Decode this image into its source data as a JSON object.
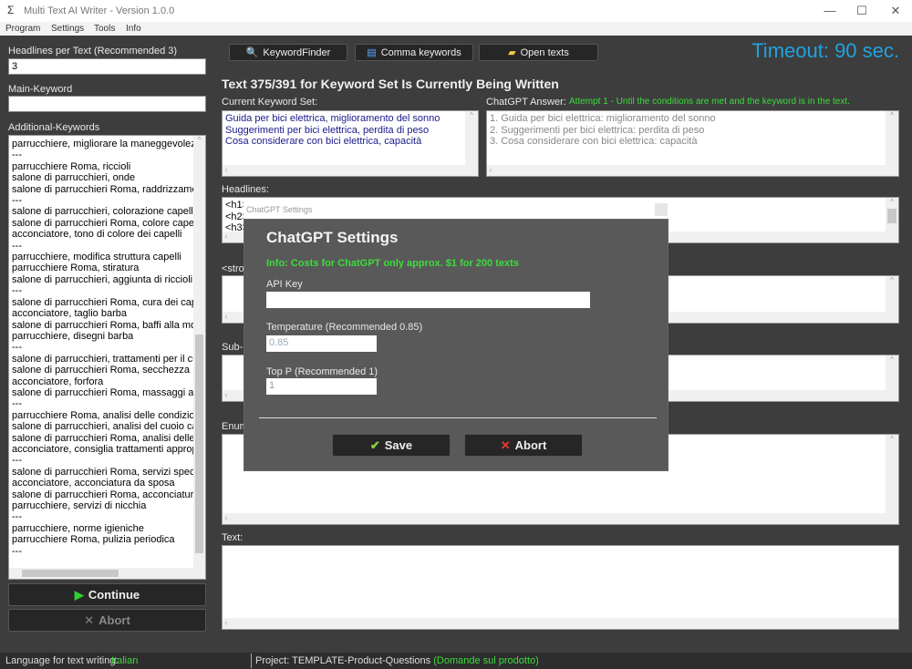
{
  "window": {
    "title": "Multi Text AI Writer - Version 1.0.0",
    "minimize": "—",
    "maximize": "☐",
    "close": "✕"
  },
  "menu": [
    "Program",
    "Settings",
    "Tools",
    "Info"
  ],
  "left": {
    "headlines_label": "Headlines per Text (Recommended 3)",
    "headlines_value": "3",
    "main_keyword_label": "Main-Keyword",
    "main_keyword_value": "",
    "additional_label": "Additional-Keywords",
    "additional_keywords": [
      "parrucchiere, migliorare la maneggevolezza",
      "---",
      "parrucchiere Roma, riccioli",
      "salone di parrucchieri, onde",
      "salone di parrucchieri Roma, raddrizzamento",
      "---",
      "salone di parrucchieri, colorazione capelli",
      "salone di parrucchieri Roma, colore capelli",
      "acconciatore, tono di colore dei capelli",
      "---",
      "parrucchiere, modifica struttura capelli",
      "parrucchiere Roma, stiratura",
      "salone di parrucchieri, aggiunta di riccioli",
      "---",
      "salone di parrucchieri Roma, cura dei capelli",
      "acconciatore, taglio barba",
      "salone di parrucchieri Roma, baffi alla moda",
      "parrucchiere, disegni barba",
      "---",
      "salone di parrucchieri, trattamenti per il cuoio",
      "salone di parrucchieri Roma, secchezza",
      "acconciatore, forfora",
      "salone di parrucchieri Roma, massaggi al cuoio",
      "---",
      "parrucchiere Roma, analisi delle condizioni",
      "salone di parrucchieri, analisi del cuoio capelluto",
      "salone di parrucchieri Roma, analisi delle condizioni",
      "acconciatore, consiglia trattamenti appropriati",
      "---",
      "salone di parrucchieri Roma, servizi speciali",
      "acconciatore, acconciatura da sposa",
      "salone di parrucchieri Roma, acconciature di",
      "parrucchiere, servizi di nicchia",
      "---",
      "parrucchiere, norme igieniche",
      "parrucchiere Roma, pulizia periodica",
      "---"
    ],
    "continue_label": "Continue",
    "abort_label": "Abort"
  },
  "toolbar": {
    "keywordfinder": "KeywordFinder",
    "comma_keywords": "Comma keywords",
    "open_texts": "Open texts"
  },
  "timeout": "Timeout: 90 sec.",
  "heading": "Text 375/391 for Keyword Set Is Currently Being Written",
  "current_set": {
    "label": "Current Keyword Set:",
    "lines": "Guida per bici elettrica, miglioramento del sonno\nSuggerimenti per bici elettrica, perdita di peso\nCosa considerare con bici elettrica, capacità"
  },
  "answer": {
    "label": "ChatGPT Answer:",
    "status": "Attempt 1 - Until the conditions are met and the keyword is in the text.",
    "lines": "1. Guida per bici elettrica: miglioramento del sonno\n2. Suggerimenti per bici elettrica: perdita di peso\n3. Cosa considerare con bici elettrica: capacità"
  },
  "headlines": {
    "label": "Headlines:",
    "lines": "<h1>\n<h2>\n<h3>"
  },
  "strong": {
    "label": "<strong>"
  },
  "subh": {
    "label": "Sub-h"
  },
  "enum": {
    "label": "Enum"
  },
  "text": {
    "label": "Text:"
  },
  "dialog": {
    "window_title": "ChatGPT Settings",
    "title": "ChatGPT Settings",
    "info": "Info: Costs for ChatGPT only approx. $1 for 200 texts",
    "api_key_label": "API Key",
    "api_key_value": "",
    "temperature_label": "Temperature (Recommended 0.85)",
    "temperature_value": "0.85",
    "top_p_label": "Top P (Recommended 1)",
    "top_p_value": "1",
    "save_label": "Save",
    "abort_label": "Abort"
  },
  "status": {
    "language_label": "Language for text writing:",
    "language": "Italian",
    "project_label": "Project:",
    "project": "TEMPLATE-Product-Questions",
    "project_note": "(Domande sul prodotto)"
  },
  "colors": {
    "accent": "#1fa3e0",
    "green": "#3cdc3c",
    "bg": "#3d3d3d",
    "keyword_text": "#1a1a8c"
  }
}
